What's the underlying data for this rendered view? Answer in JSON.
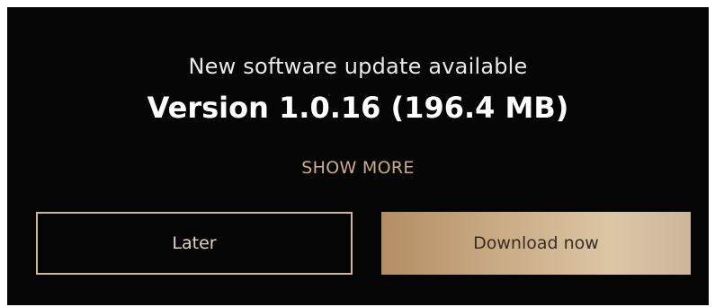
{
  "dialog": {
    "subtitle": "New software update available",
    "version": "Version 1.0.16 (196.4 MB)",
    "show_more_label": "SHOW MORE",
    "later_label": "Later",
    "download_label": "Download now"
  },
  "colors": {
    "background": "#050505",
    "accent_gold": "#c9ad89",
    "text_white": "#ffffff"
  }
}
